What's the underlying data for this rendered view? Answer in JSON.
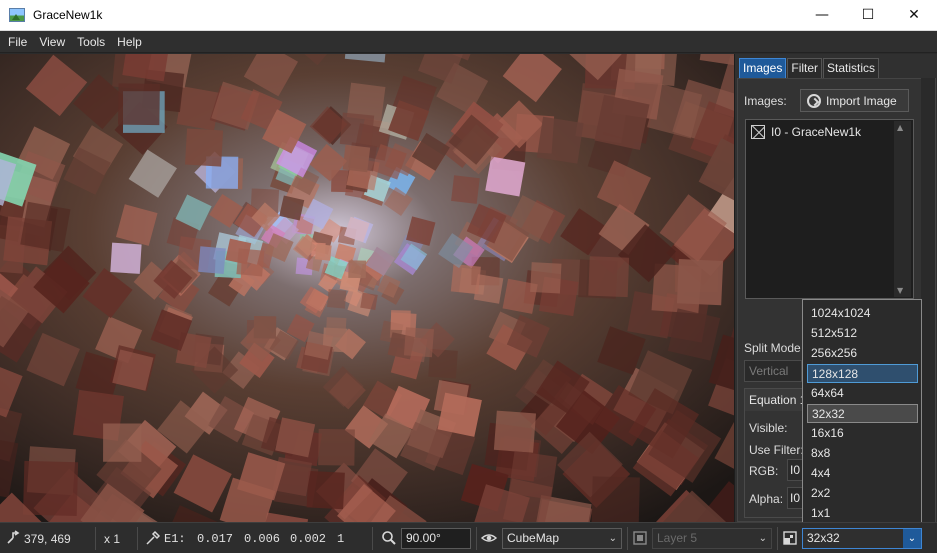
{
  "window": {
    "title": "GraceNew1k",
    "minimize": "—",
    "maximize": "☐",
    "close": "✕"
  },
  "menu": [
    "File",
    "View",
    "Tools",
    "Help"
  ],
  "panel": {
    "tabs": [
      "Images",
      "Filter",
      "Statistics"
    ],
    "active_tab": "Images",
    "images_label": "Images:",
    "import_button": "Import Image",
    "image_list": [
      "I0 - GraceNew1k"
    ],
    "split_mode_label": "Split Mode",
    "split_mode_value": "Vertical",
    "equation_header": "Equation 1",
    "visible_label": "Visible:",
    "use_filter_label": "Use Filter:",
    "rgb_label": "RGB:",
    "rgb_value": "I0",
    "alpha_label": "Alpha:",
    "alpha_value": "I0"
  },
  "resolution_dropdown": {
    "options": [
      "1024x1024",
      "512x512",
      "256x256",
      "128x128",
      "64x64",
      "32x32",
      "16x16",
      "8x8",
      "4x4",
      "2x2",
      "1x1"
    ],
    "hovered": "128x128",
    "selected": "32x32"
  },
  "status": {
    "coords": "379, 469",
    "zoom": "x 1",
    "pixel_label": "E1:",
    "pixel_values": [
      "0.017",
      "0.006",
      "0.002",
      "1"
    ],
    "fov": "90.00°",
    "projection": "CubeMap",
    "layer": "Layer 5",
    "resolution": "32x32"
  },
  "colors": {
    "accent": "#1f5a9a",
    "accent_border": "#3e86d4",
    "background": "#2b2b2b"
  }
}
